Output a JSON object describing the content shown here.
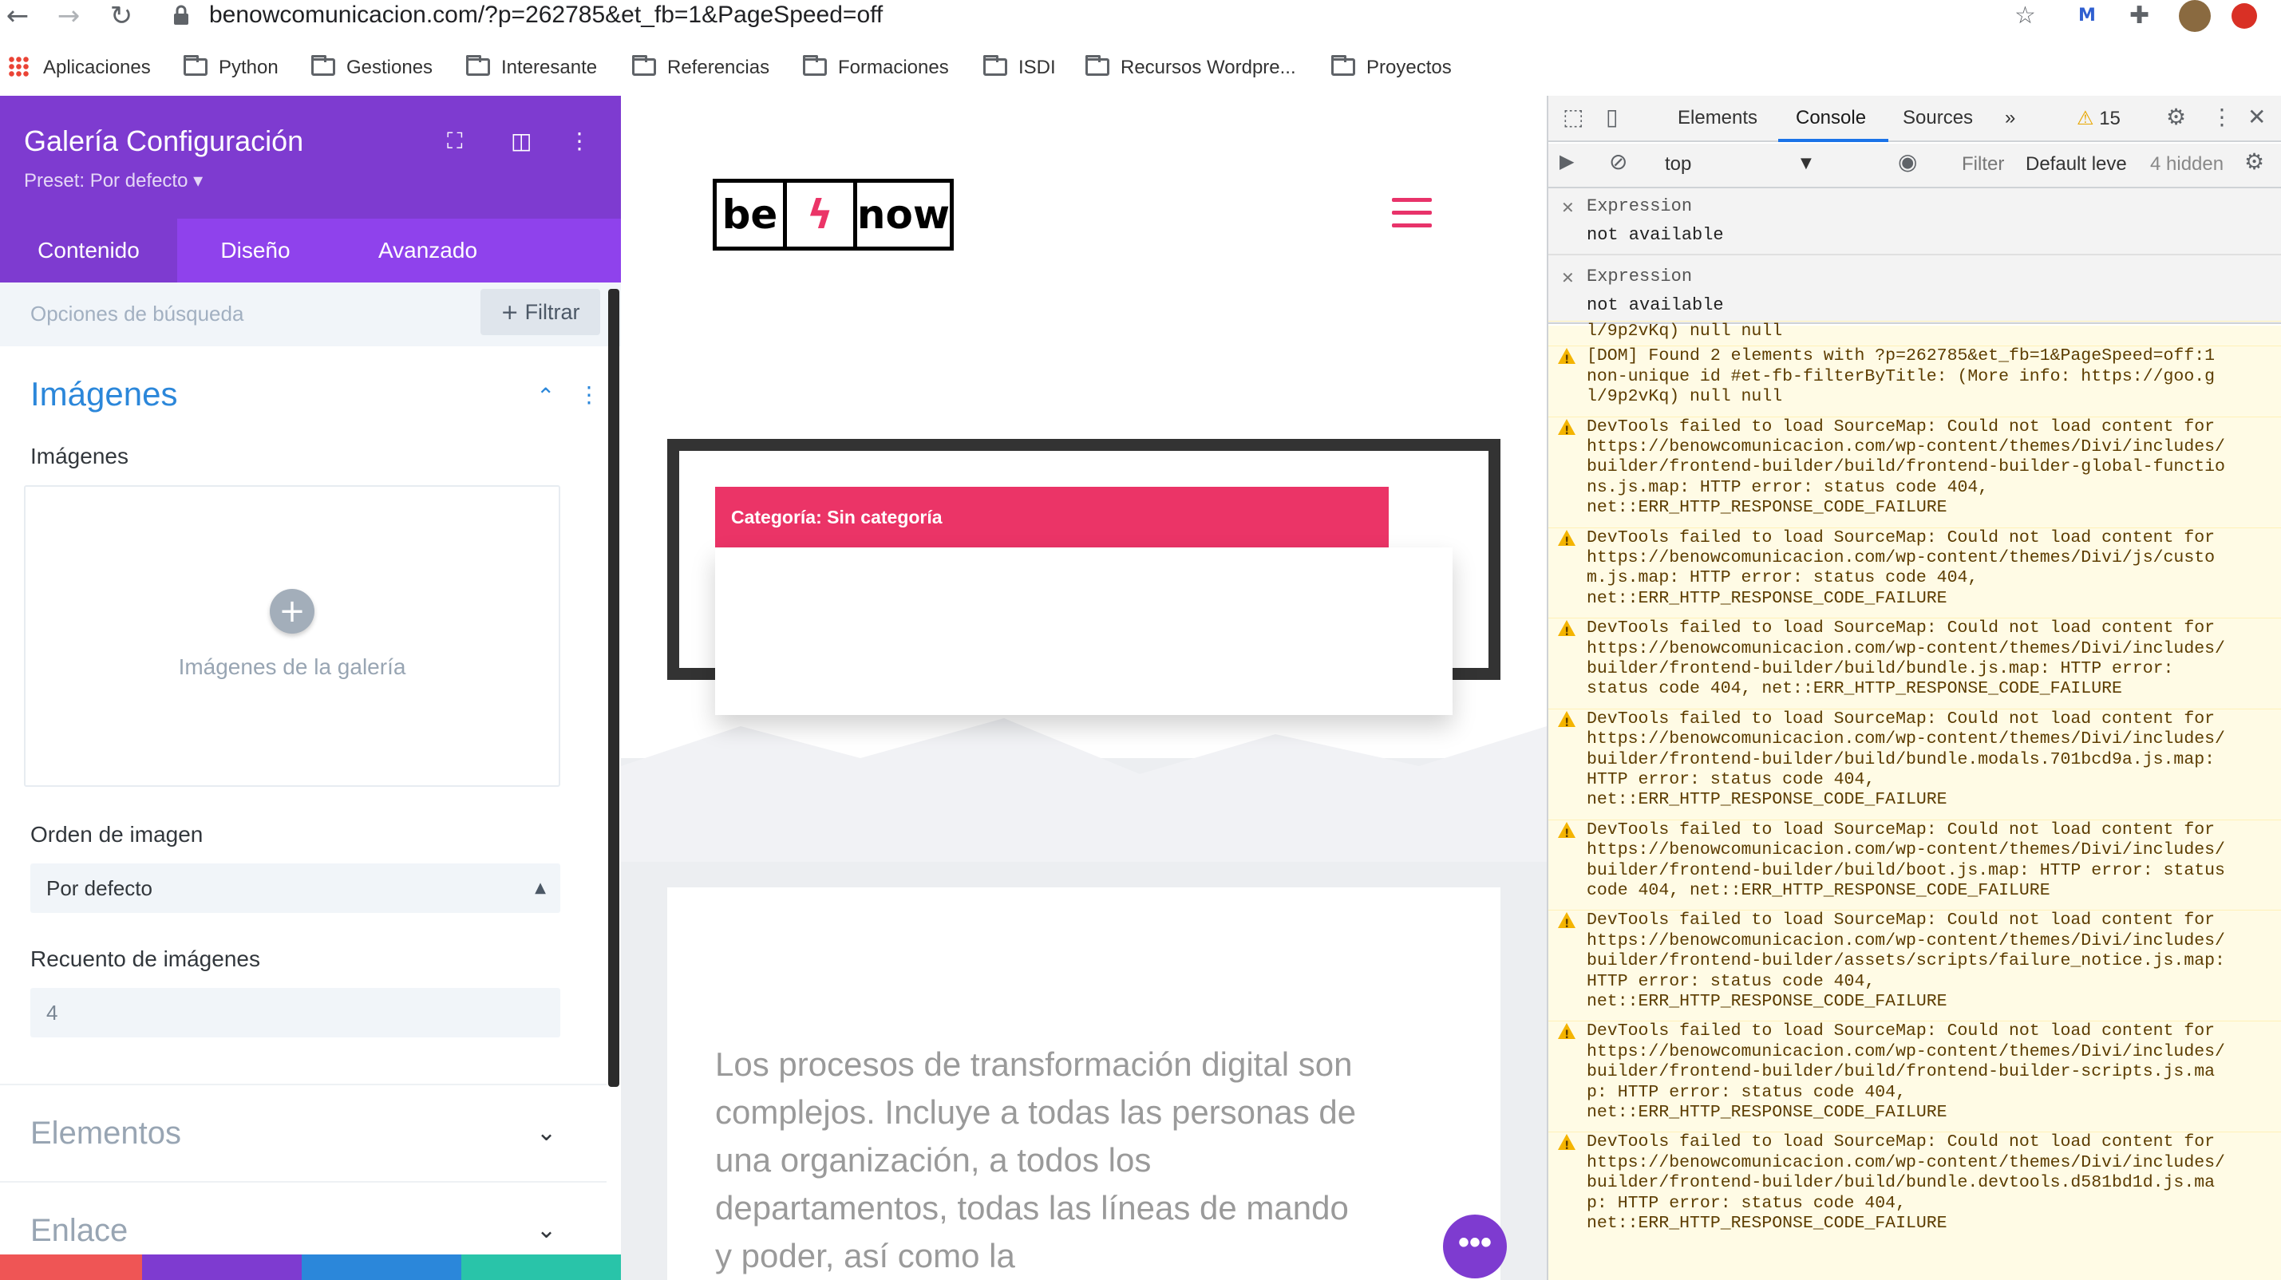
{
  "browser": {
    "url": "benowcomunicacion.com/?p=262785&et_fb=1&PageSpeed=off",
    "bookmarks": [
      "Aplicaciones",
      "Python",
      "Gestiones",
      "Interesante",
      "Referencias",
      "Formaciones",
      "ISDI",
      "Recursos Wordpre...",
      "Proyectos"
    ]
  },
  "panel": {
    "title": "Galería Configuración",
    "preset": "Preset: Por defecto ▾",
    "tabs": [
      "Contenido",
      "Diseño",
      "Avanzado"
    ],
    "search_placeholder": "Opciones de búsqueda",
    "filter_label": "Filtrar",
    "section_title": "Imágenes",
    "images_label": "Imágenes",
    "gallery_placeholder": "Imágenes de la galería",
    "order_label": "Orden de imagen",
    "order_value": "Por defecto",
    "count_label": "Recuento de imágenes",
    "count_value": "4",
    "collapsed_sections": [
      "Elementos",
      "Enlace"
    ],
    "colors": {
      "header": "#7e3bd0",
      "tabs": "#8f42ec",
      "accent": "#2b87da"
    }
  },
  "preview": {
    "logo_parts": [
      "be",
      "",
      "now"
    ],
    "category_text": "Categoría: Sin categoría",
    "paragraph": "Los procesos de transformación digital son complejos. Incluye a todas las personas de una organización, a todos los departamentos, todas las líneas de mando y poder, así como la",
    "fab_label": "•••",
    "colors": {
      "brand_pink": "#eb3467",
      "purple": "#7e3bd0"
    }
  },
  "devtools": {
    "tabs": [
      "Elements",
      "Console",
      "Sources"
    ],
    "more_tabs": "»",
    "warning_count": "15",
    "context": "top",
    "filter_placeholder": "Filter",
    "levels": "Default leve",
    "hidden": "4 hidden",
    "expressions": [
      {
        "name": "Expression",
        "value": "not available"
      },
      {
        "name": "Expression",
        "value": "not available"
      }
    ],
    "messages": [
      "l/9p2vKq) null null",
      "[DOM] Found 2 elements with ?p=262785&et_fb=1&PageSpeed=off:1\nnon-unique id #et-fb-filterByTitle: (More info: https://goo.g\nl/9p2vKq) null null",
      "DevTools failed to load SourceMap: Could not load content for\nhttps://benowcomunicacion.com/wp-content/themes/Divi/includes/\nbuilder/frontend-builder/build/frontend-builder-global-functio\nns.js.map: HTTP error: status code 404,\nnet::ERR_HTTP_RESPONSE_CODE_FAILURE",
      "DevTools failed to load SourceMap: Could not load content for\nhttps://benowcomunicacion.com/wp-content/themes/Divi/js/custo\nm.js.map: HTTP error: status code 404,\nnet::ERR_HTTP_RESPONSE_CODE_FAILURE",
      "DevTools failed to load SourceMap: Could not load content for\nhttps://benowcomunicacion.com/wp-content/themes/Divi/includes/\nbuilder/frontend-builder/build/bundle.js.map: HTTP error:\nstatus code 404, net::ERR_HTTP_RESPONSE_CODE_FAILURE",
      "DevTools failed to load SourceMap: Could not load content for\nhttps://benowcomunicacion.com/wp-content/themes/Divi/includes/\nbuilder/frontend-builder/build/bundle.modals.701bcd9a.js.map:\nHTTP error: status code 404,\nnet::ERR_HTTP_RESPONSE_CODE_FAILURE",
      "DevTools failed to load SourceMap: Could not load content for\nhttps://benowcomunicacion.com/wp-content/themes/Divi/includes/\nbuilder/frontend-builder/build/boot.js.map: HTTP error: status\ncode 404, net::ERR_HTTP_RESPONSE_CODE_FAILURE",
      "DevTools failed to load SourceMap: Could not load content for\nhttps://benowcomunicacion.com/wp-content/themes/Divi/includes/\nbuilder/frontend-builder/assets/scripts/failure_notice.js.map:\nHTTP error: status code 404,\nnet::ERR_HTTP_RESPONSE_CODE_FAILURE",
      "DevTools failed to load SourceMap: Could not load content for\nhttps://benowcomunicacion.com/wp-content/themes/Divi/includes/\nbuilder/frontend-builder/build/frontend-builder-scripts.js.ma\np: HTTP error: status code 404,\nnet::ERR_HTTP_RESPONSE_CODE_FAILURE",
      "DevTools failed to load SourceMap: Could not load content for\nhttps://benowcomunicacion.com/wp-content/themes/Divi/includes/\nbuilder/frontend-builder/build/bundle.devtools.d581bd1d.js.ma\np: HTTP error: status code 404,\nnet::ERR_HTTP_RESPONSE_CODE_FAILURE"
    ],
    "message_has_warning": [
      false,
      true,
      true,
      true,
      true,
      true,
      true,
      true,
      true,
      true
    ]
  }
}
